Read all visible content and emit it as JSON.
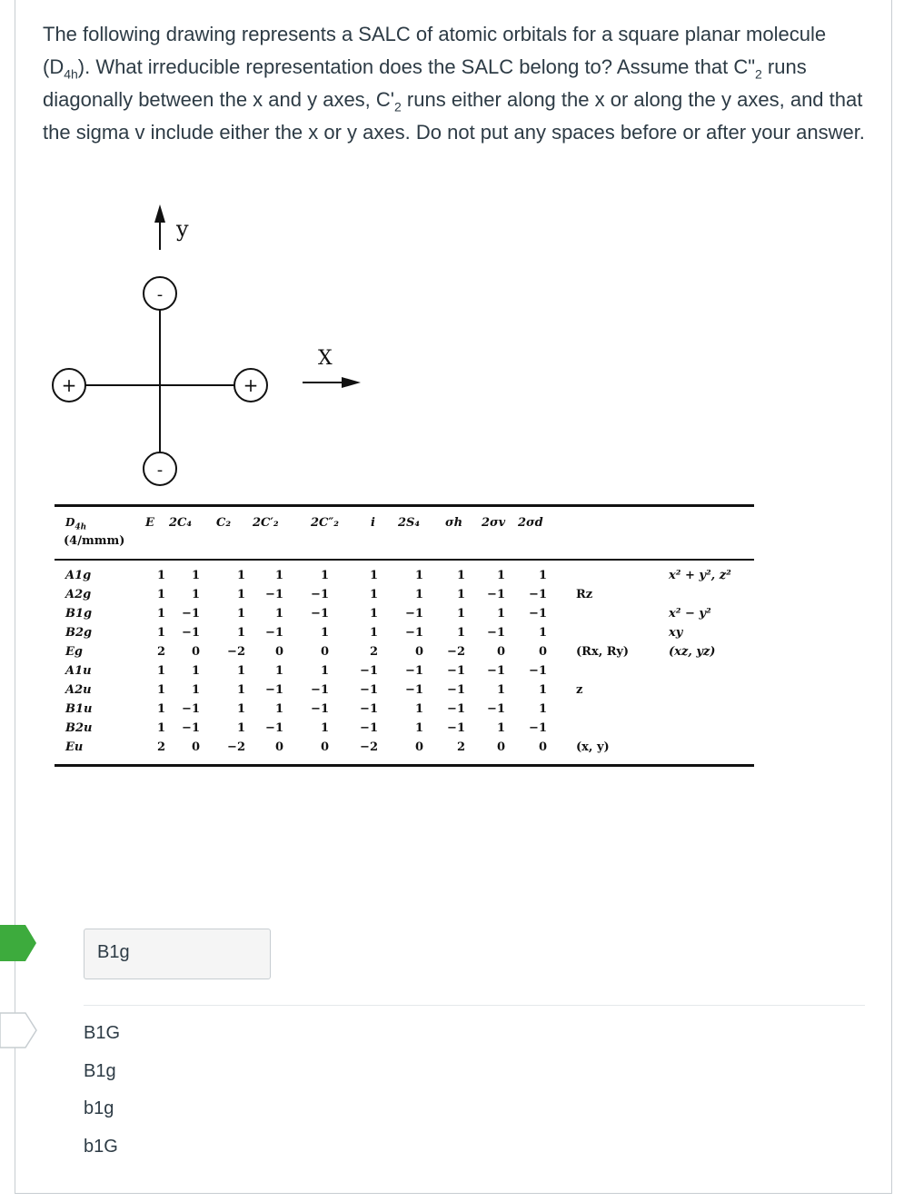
{
  "question": {
    "part1": "The following drawing represents a SALC of atomic orbitals for a square planar molecule (D",
    "sub1": "4h",
    "part2": "). What irreducible representation does the SALC belong to? Assume that C\"",
    "sub2": "2",
    "part3": " runs diagonally between the x and y axes, C'",
    "sub3": "2",
    "part4": " runs either along the x or along the y axes, and that the sigma v include either the x or y axes. Do not put any spaces before or after your answer."
  },
  "diagram": {
    "y_axis_label": "y",
    "x_axis_label": "X",
    "lobes": {
      "top": "-",
      "bottom": "-",
      "left": "+",
      "right": "+"
    }
  },
  "character_table": {
    "group": "D",
    "group_sub": "4h",
    "group_alt": "(4/mmm)",
    "headers": [
      "E",
      "2C₄",
      "C₂",
      "2C′₂",
      "2C″₂",
      "i",
      "2S₄",
      "σh",
      "2σv",
      "2σd"
    ],
    "rows": [
      {
        "label": "A1g",
        "values": [
          "1",
          "1",
          "1",
          "1",
          "1",
          "1",
          "1",
          "1",
          "1",
          "1"
        ],
        "basis": "",
        "quad": "x² + y², z²"
      },
      {
        "label": "A2g",
        "values": [
          "1",
          "1",
          "1",
          "−1",
          "−1",
          "1",
          "1",
          "1",
          "−1",
          "−1"
        ],
        "basis": "Rz",
        "quad": ""
      },
      {
        "label": "B1g",
        "values": [
          "1",
          "−1",
          "1",
          "1",
          "−1",
          "1",
          "−1",
          "1",
          "1",
          "−1"
        ],
        "basis": "",
        "quad": "x² − y²"
      },
      {
        "label": "B2g",
        "values": [
          "1",
          "−1",
          "1",
          "−1",
          "1",
          "1",
          "−1",
          "1",
          "−1",
          "1"
        ],
        "basis": "",
        "quad": "xy"
      },
      {
        "label": "Eg",
        "values": [
          "2",
          "0",
          "−2",
          "0",
          "0",
          "2",
          "0",
          "−2",
          "0",
          "0"
        ],
        "basis": "(Rx, Ry)",
        "quad": "(xz, yz)"
      },
      {
        "label": "A1u",
        "values": [
          "1",
          "1",
          "1",
          "1",
          "1",
          "−1",
          "−1",
          "−1",
          "−1",
          "−1"
        ],
        "basis": "",
        "quad": ""
      },
      {
        "label": "A2u",
        "values": [
          "1",
          "1",
          "1",
          "−1",
          "−1",
          "−1",
          "−1",
          "−1",
          "1",
          "1"
        ],
        "basis": "z",
        "quad": ""
      },
      {
        "label": "B1u",
        "values": [
          "1",
          "−1",
          "1",
          "1",
          "−1",
          "−1",
          "1",
          "−1",
          "−1",
          "1"
        ],
        "basis": "",
        "quad": ""
      },
      {
        "label": "B2u",
        "values": [
          "1",
          "−1",
          "1",
          "−1",
          "1",
          "−1",
          "1",
          "−1",
          "1",
          "−1"
        ],
        "basis": "",
        "quad": ""
      },
      {
        "label": "Eu",
        "values": [
          "2",
          "0",
          "−2",
          "0",
          "0",
          "−2",
          "0",
          "2",
          "0",
          "0"
        ],
        "basis": "(x, y)",
        "quad": ""
      }
    ]
  },
  "answer": {
    "entered_value": "B1g",
    "alternatives": [
      "B1G",
      "B1g",
      "b1g",
      "b1G"
    ]
  },
  "colors": {
    "correct_arrow": "#3dab3d",
    "text": "#2d3b45",
    "border": "#c7cdd1"
  }
}
